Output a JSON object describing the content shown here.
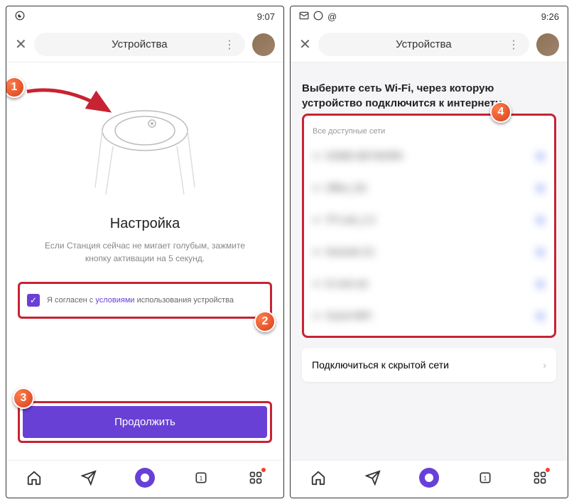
{
  "colors": {
    "accent": "#6940d6",
    "danger_border": "#c82333",
    "marker_grad_a": "#ff7b4a",
    "marker_grad_b": "#d9411e"
  },
  "phone1": {
    "status": {
      "time": "9:07"
    },
    "header": {
      "title": "Устройства"
    },
    "setup": {
      "title": "Настройка",
      "description": "Если Станция сейчас не мигает голубым, зажмите кнопку активации на 5 секунд."
    },
    "consent": {
      "prefix": "Я согласен с ",
      "link": "условиями",
      "suffix": " использования устройства"
    },
    "continue_label": "Продолжить"
  },
  "phone2": {
    "status": {
      "time": "9:26"
    },
    "header": {
      "title": "Устройства"
    },
    "wifi": {
      "title": "Выберите сеть Wi-Fi, через которую устройство подключится к интернету",
      "subtitle": "Все доступные сети",
      "hidden_network_label": "Подключиться к скрытой сети",
      "networks": [
        {
          "name": "HOME-NETWORK"
        },
        {
          "name": "Office_5G"
        },
        {
          "name": "TP-Link_2.4"
        },
        {
          "name": "Keenetic-01"
        },
        {
          "name": "D-Link-net"
        },
        {
          "name": "Guest-WiFi"
        }
      ]
    }
  },
  "markers": {
    "m1": "1",
    "m2": "2",
    "m3": "3",
    "m4": "4"
  }
}
